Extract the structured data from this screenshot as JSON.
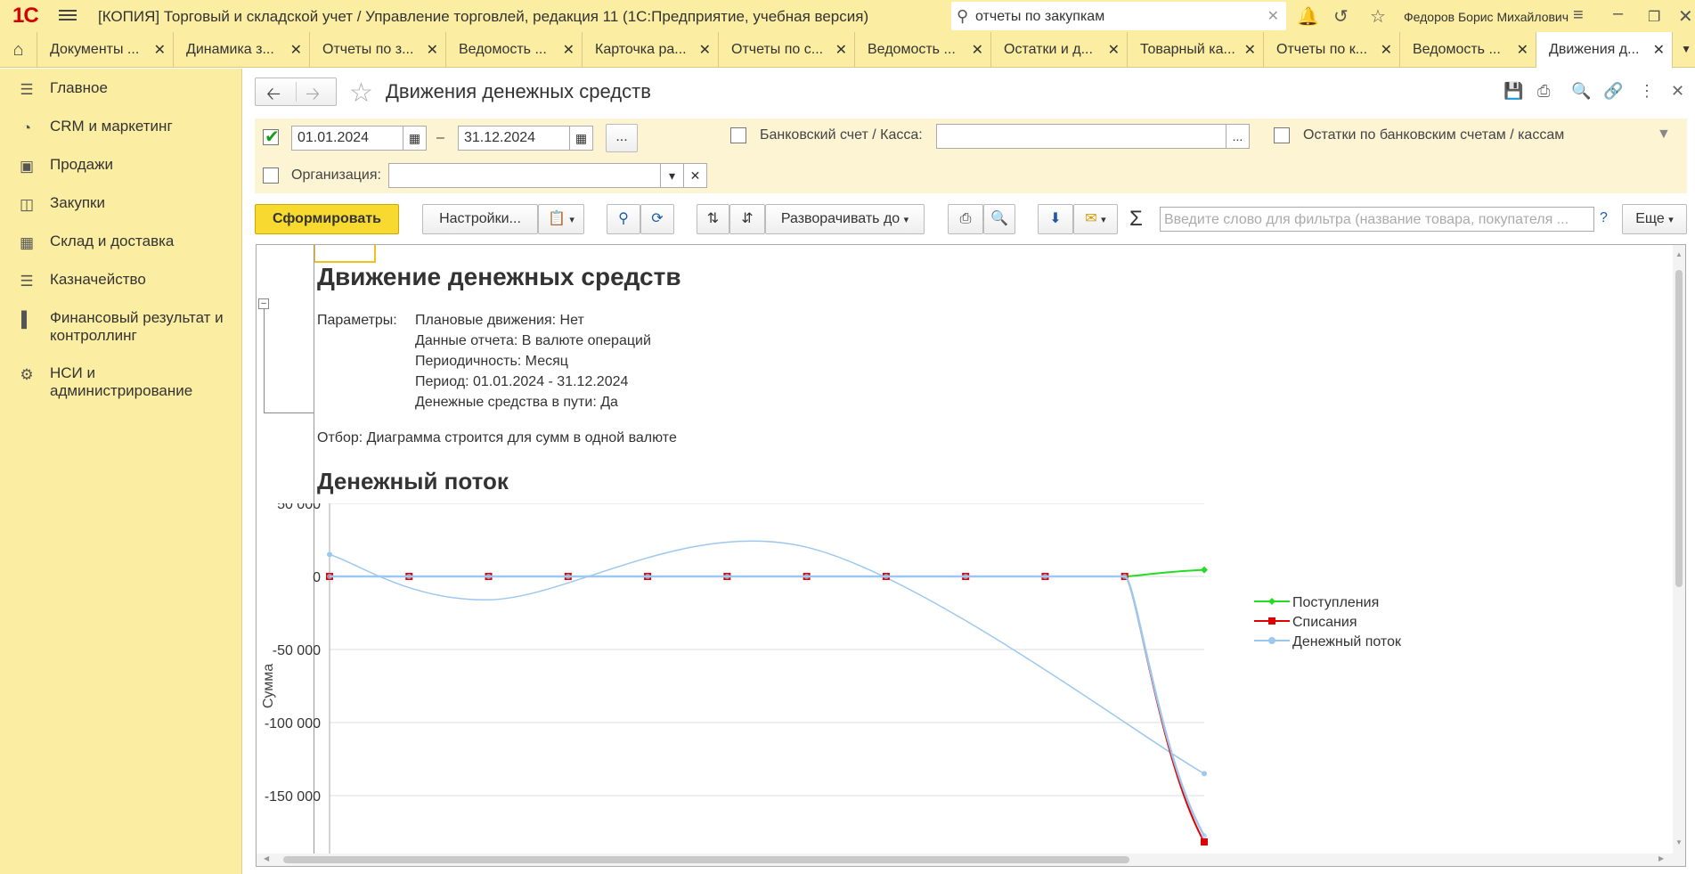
{
  "app": {
    "logo": "1С",
    "title": "[КОПИЯ] Торговый и складской учет / Управление торговлей, редакция 11  (1С:Предприятие, учебная версия)",
    "search_value": "отчеты по закупкам",
    "user": "Федоров Борис Михайлович"
  },
  "tabs": [
    {
      "label": "Документы ..."
    },
    {
      "label": "Динамика з..."
    },
    {
      "label": "Отчеты по з..."
    },
    {
      "label": "Ведомость ..."
    },
    {
      "label": "Карточка ра..."
    },
    {
      "label": "Отчеты по с..."
    },
    {
      "label": "Ведомость ..."
    },
    {
      "label": "Остатки и д..."
    },
    {
      "label": "Товарный ка..."
    },
    {
      "label": "Отчеты по к..."
    },
    {
      "label": "Ведомость ..."
    },
    {
      "label": "Движения д..."
    }
  ],
  "sidebar": {
    "items": [
      {
        "label": "Главное",
        "icon": "menu-icon"
      },
      {
        "label": "CRM и маркетинг",
        "icon": "pie-chart-icon"
      },
      {
        "label": "Продажи",
        "icon": "bag-icon"
      },
      {
        "label": "Закупки",
        "icon": "cart-icon"
      },
      {
        "label": "Склад и доставка",
        "icon": "warehouse-icon"
      },
      {
        "label": "Казначейство",
        "icon": "coins-icon"
      },
      {
        "label": "Финансовый результат и контроллинг",
        "icon": "bar-chart-icon"
      },
      {
        "label": "НСИ и администрирование",
        "icon": "gear-icon"
      }
    ]
  },
  "form": {
    "title": "Движения денежных средств",
    "date_from": "01.01.2024",
    "date_to": "31.12.2024",
    "date_sep": "–",
    "ellipsis": "...",
    "bank_label": "Банковский счет / Касса:",
    "bank_value": "",
    "balances_label": "Остатки по банковским счетам / кассам",
    "org_label": "Организация:",
    "org_value": ""
  },
  "toolbar": {
    "generate": "Сформировать",
    "settings": "Настройки...",
    "expand": "Разворачивать до",
    "filter_placeholder": "Введите слово для фильтра (название товара, покупателя ...",
    "help": "?",
    "more": "Еще"
  },
  "report": {
    "title": "Движение денежных средств",
    "params_label": "Параметры:",
    "params": [
      "Плановые движения: Нет",
      "Данные отчета: В валюте операций",
      "Периодичность: Месяц",
      "Период: 01.01.2024 - 31.12.2024",
      "Денежные средства в пути: Да"
    ],
    "filter": "Отбор: Диаграмма строится для сумм в одной валюте",
    "section": "Денежный поток"
  },
  "colors": {
    "accent": "#f8d92f",
    "panel": "#fbeda1",
    "series_income": "#22dd22",
    "series_expense": "#e00000",
    "series_flow": "#9cc8f0"
  },
  "chart_data": {
    "type": "line",
    "title": "",
    "xlabel": "",
    "ylabel": "Сумма",
    "ylim": [
      -185000,
      50000
    ],
    "yticks": [
      50000,
      0,
      -50000,
      -100000,
      -150000
    ],
    "ytick_labels": [
      "50 000",
      "0",
      "-50 000",
      "-100 000",
      "-150 000"
    ],
    "x": [
      1,
      2,
      3,
      4,
      5,
      6,
      7,
      8,
      9,
      10,
      11,
      12
    ],
    "legend_position": "right",
    "series": [
      {
        "name": "Поступления",
        "values": [
          0,
          0,
          0,
          0,
          0,
          0,
          0,
          0,
          0,
          0,
          0,
          4500
        ]
      },
      {
        "name": "Списания",
        "values": [
          0,
          0,
          0,
          0,
          0,
          0,
          0,
          0,
          0,
          0,
          0,
          -182000
        ]
      },
      {
        "name": "Денежный поток",
        "values": [
          0,
          0,
          0,
          0,
          0,
          0,
          0,
          0,
          0,
          0,
          0,
          -177500
        ]
      }
    ],
    "trend": {
      "name": "Денежный поток",
      "points": [
        [
          1,
          15000
        ],
        [
          3,
          -16000
        ],
        [
          7,
          20000
        ],
        [
          12,
          -135000
        ]
      ]
    }
  }
}
